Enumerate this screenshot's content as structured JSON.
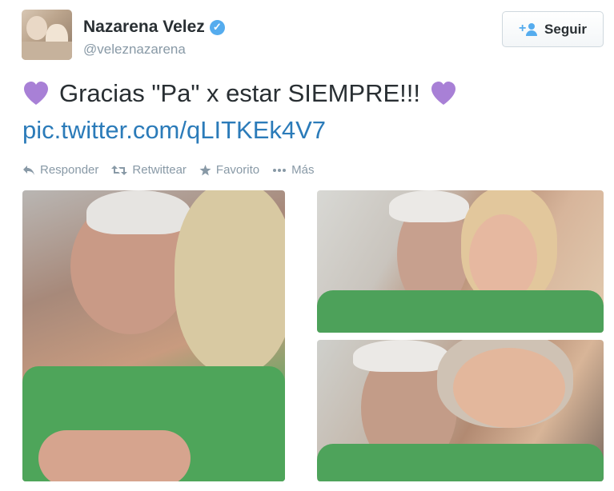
{
  "user": {
    "name": "Nazarena Velez",
    "handle": "@veleznazarena",
    "verified_glyph": "✓"
  },
  "follow_button": {
    "label": "Seguir",
    "icon": "add-user-icon"
  },
  "tweet": {
    "text": "Gracias \"Pa\" x estar SIEMPRE!!!",
    "link": "pic.twitter.com/qLITKEk4V7",
    "heart_color": "#a880d6"
  },
  "actions": [
    {
      "label": "Responder",
      "icon": "reply-icon"
    },
    {
      "label": "Retwittear",
      "icon": "retweet-icon"
    },
    {
      "label": "Favorito",
      "icon": "star-icon"
    },
    {
      "label": "Más",
      "icon": "more-icon"
    }
  ],
  "colors": {
    "link": "#2b7bb9",
    "muted": "#8899a6",
    "verified": "#55acee"
  }
}
